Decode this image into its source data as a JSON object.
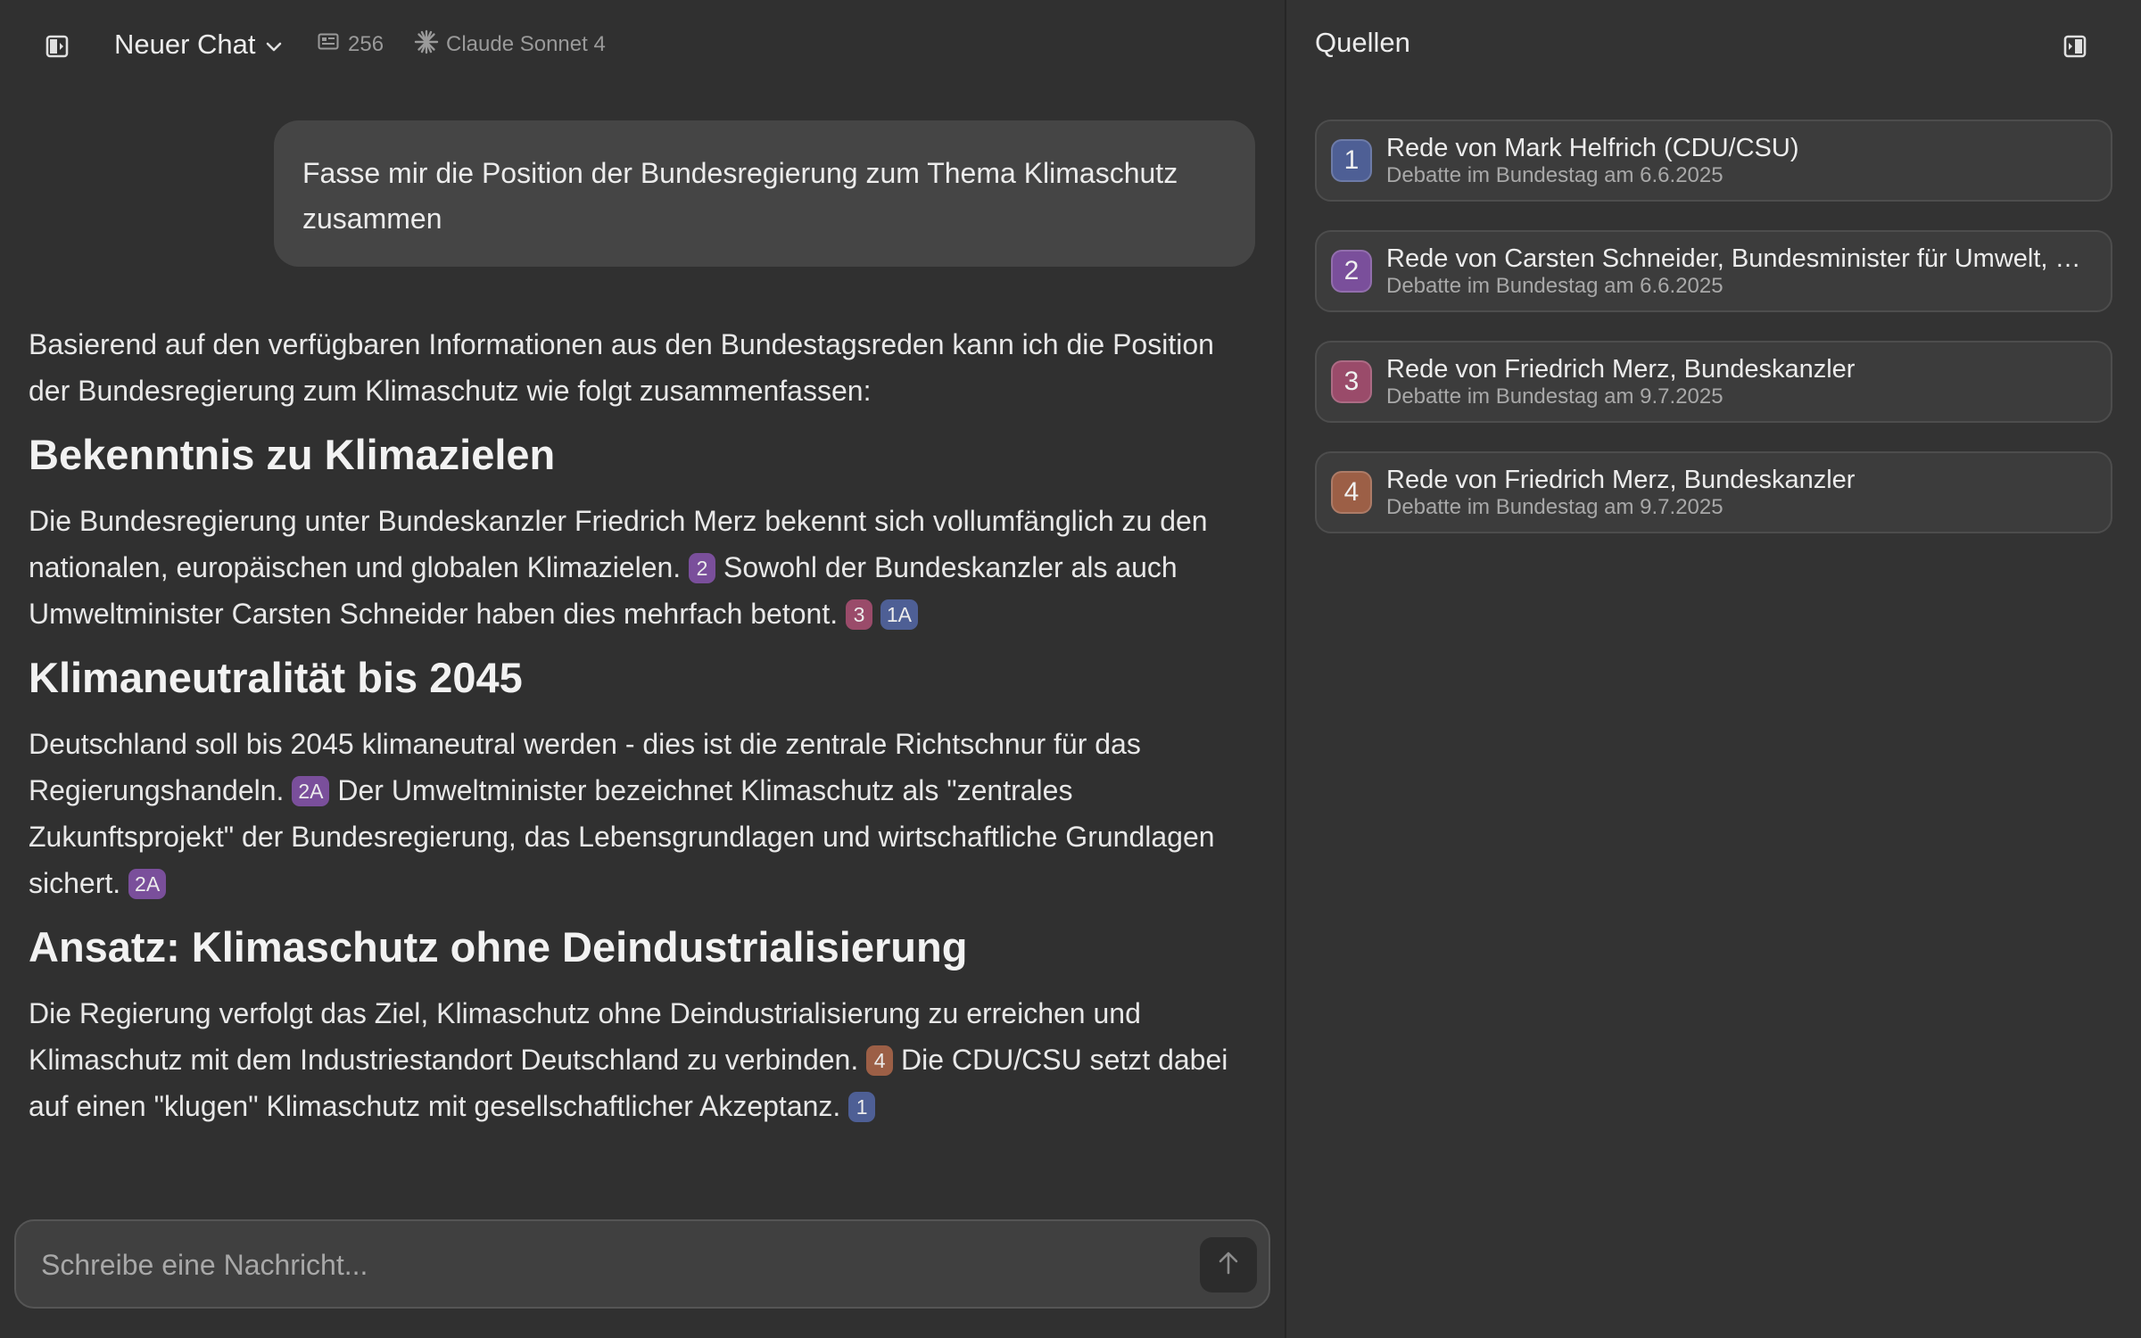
{
  "header": {
    "chat_title": "Neuer Chat",
    "message_count": "256",
    "model": "Claude Sonnet 4"
  },
  "user_message": "Fasse mir die Position der Bundesregierung zum Thema Klimaschutz zusammen",
  "response": {
    "intro": "Basierend auf den verfügbaren Informationen aus den Bundestagsreden kann ich die Position der Bundesregierung zum Klimaschutz wie folgt zusammenfassen:",
    "sections": [
      {
        "heading": "Bekenntnis zu Klimazielen",
        "p1": "Die Bundesregierung unter Bundeskanzler Friedrich Merz bekennt sich vollumfänglich zu den nationalen, europäischen und globalen Klimazielen.",
        "cite1": "2",
        "p2": "Sowohl der Bundeskanzler als auch Umweltminister Carsten Schneider haben dies mehrfach betont.",
        "cite2": "3",
        "cite3": "1A"
      },
      {
        "heading": "Klimaneutralität bis 2045",
        "p1": "Deutschland soll bis 2045 klimaneutral werden - dies ist die zentrale Richtschnur für das Regierungshandeln.",
        "cite1": "2A",
        "p2": "Der Umweltminister bezeichnet Klimaschutz als \"zentrales Zukunftsprojekt\" der Bundesregierung, das Lebensgrundlagen und wirtschaftliche Grundlagen sichert.",
        "cite2": "2A"
      },
      {
        "heading": "Ansatz: Klimaschutz ohne Deindustrialisierung",
        "p1": "Die Regierung verfolgt das Ziel, Klimaschutz ohne Deindustrialisierung zu erreichen und Klimaschutz mit dem Industriestandort Deutschland zu verbinden.",
        "cite1": "4",
        "p2": "Die CDU/CSU setzt dabei auf einen \"klugen\" Klimaschutz mit gesellschaftlicher Akzeptanz.",
        "cite2": "1"
      }
    ]
  },
  "composer": {
    "placeholder": "Schreibe eine Nachricht..."
  },
  "sources": {
    "title": "Quellen",
    "items": [
      {
        "num": "1",
        "title": "Rede von Mark Helfrich (CDU/CSU)",
        "subtitle": "Debatte im Bundestag am 6.6.2025",
        "color": "#4e5f95"
      },
      {
        "num": "2",
        "title": "Rede von Carsten Schneider, Bundesminister für Umwelt, Kli...",
        "subtitle": "Debatte im Bundestag am 6.6.2025",
        "color": "#7a4f9b"
      },
      {
        "num": "3",
        "title": "Rede von Friedrich Merz, Bundeskanzler",
        "subtitle": "Debatte im Bundestag am 9.7.2025",
        "color": "#9a4b6a"
      },
      {
        "num": "4",
        "title": "Rede von Friedrich Merz, Bundeskanzler",
        "subtitle": "Debatte im Bundestag am 9.7.2025",
        "color": "#9c5f46"
      }
    ]
  }
}
